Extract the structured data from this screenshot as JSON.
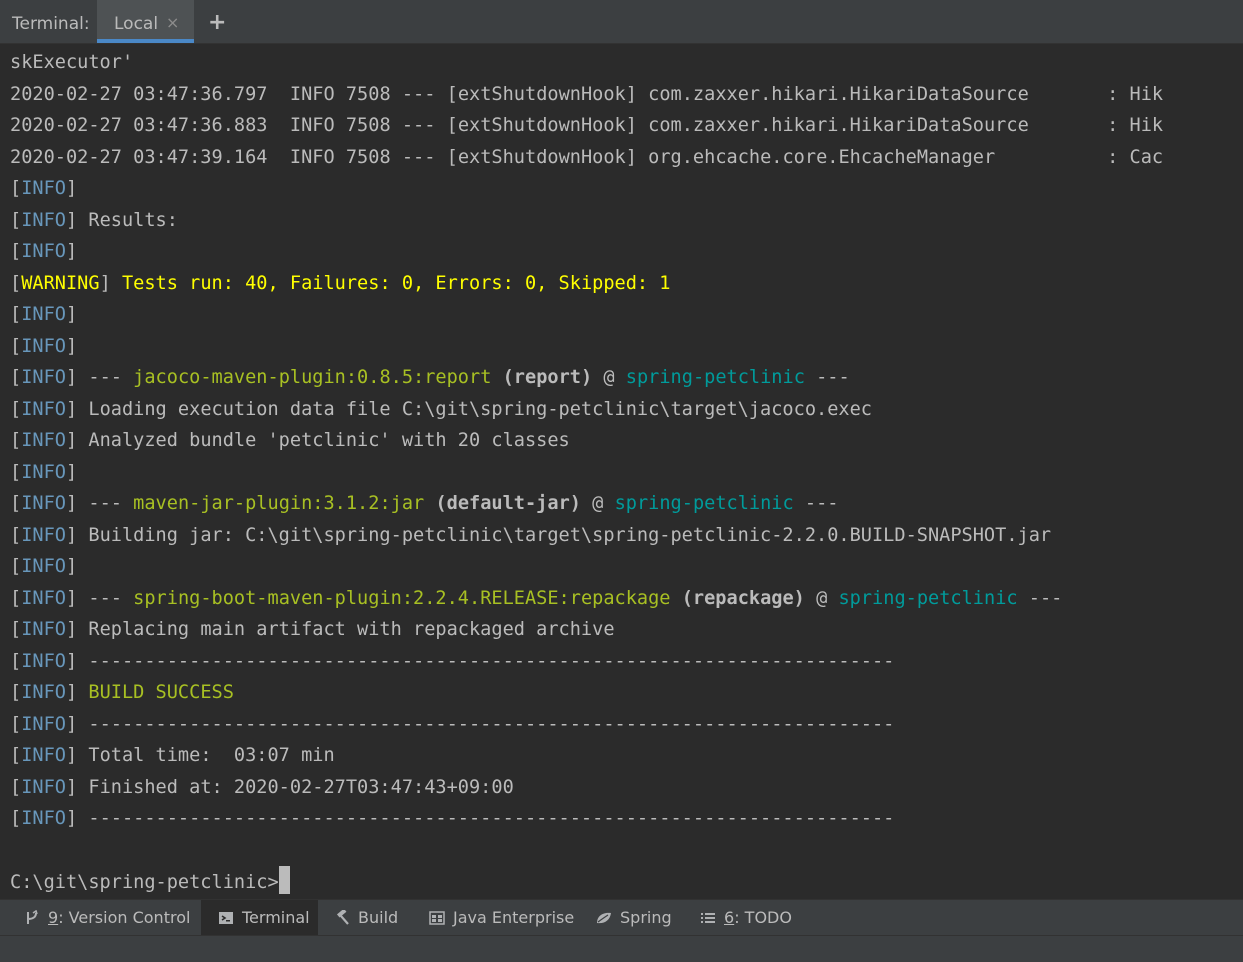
{
  "tabbar": {
    "title": "Terminal:",
    "tab_local": "Local",
    "close": "×",
    "add": "+"
  },
  "terminal": {
    "line0": "skExecutor'",
    "log1": {
      "ts": "2020-02-27 03:47:36.797",
      "lvl": "INFO",
      "pid": "7508",
      "sep": "---",
      "thread": "[extShutdownHook]",
      "logger": "com.zaxxer.hikari.HikariDataSource",
      "msg": ": Hik"
    },
    "log2": {
      "ts": "2020-02-27 03:47:36.883",
      "lvl": "INFO",
      "pid": "7508",
      "sep": "---",
      "thread": "[extShutdownHook]",
      "logger": "com.zaxxer.hikari.HikariDataSource",
      "msg": ": Hik"
    },
    "log3": {
      "ts": "2020-02-27 03:47:39.164",
      "lvl": "INFO",
      "pid": "7508",
      "sep": "---",
      "thread": "[extShutdownHook]",
      "logger": "org.ehcache.core.EhcacheManager",
      "msg": ": Cac"
    },
    "info": "INFO",
    "warning": "WARNING",
    "results": "Results:",
    "tests": "Tests run: 40, Failures: 0, Errors: 0, Skipped: 1",
    "dashes3": "---",
    "at": "@",
    "project": "spring-petclinic",
    "jacoco_plugin": "jacoco-maven-plugin:0.8.5:report",
    "jacoco_exec": "(report)",
    "loading": "Loading execution data file C:\\git\\spring-petclinic\\target\\jacoco.exec",
    "analyzed": "Analyzed bundle 'petclinic' with 20 classes",
    "jar_plugin": "maven-jar-plugin:3.1.2:jar",
    "jar_exec": "(default-jar)",
    "building": "Building jar: C:\\git\\spring-petclinic\\target\\spring-petclinic-2.2.0.BUILD-SNAPSHOT.jar",
    "boot_plugin": "spring-boot-maven-plugin:2.2.4.RELEASE:repackage",
    "boot_exec": "(repackage)",
    "replacing": "Replacing main artifact with repackaged archive",
    "separator": "------------------------------------------------------------------------",
    "build_success": "BUILD SUCCESS",
    "total_time": "Total time:  03:07 min",
    "finished": "Finished at: 2020-02-27T03:47:43+09:00",
    "prompt": "C:\\git\\spring-petclinic>"
  },
  "toolwindows": {
    "vc_num": "9",
    "vc_label": ": Version Control",
    "terminal": "Terminal",
    "build": "Build",
    "java_ee": "Java Enterprise",
    "spring": "Spring",
    "todo_num": "6",
    "todo_label": ": TODO"
  },
  "icons": [
    "vcs-icon",
    "terminal-icon",
    "hammer-icon",
    "java-enterprise-icon",
    "spring-leaf-icon",
    "todo-list-icon",
    "close-icon",
    "add-icon"
  ]
}
